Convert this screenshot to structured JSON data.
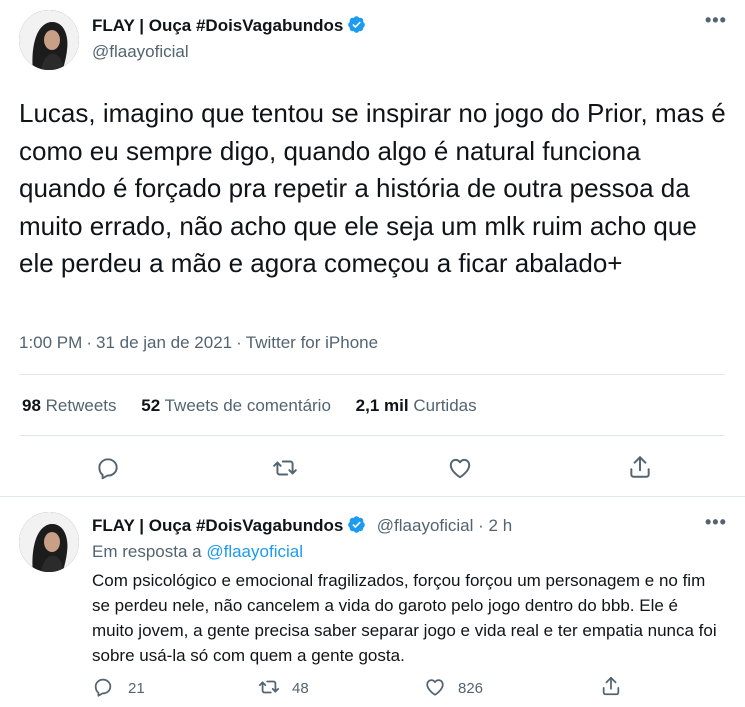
{
  "tweet": {
    "author_name": "FLAY | Ouça #DoisVagabundos",
    "handle": "@flaayoficial",
    "more_icon": "more-horizontal-icon",
    "text": "Lucas, imagino que tentou se inspirar no jogo do Prior, mas é como eu sempre digo, quando algo é natural funciona quando é forçado pra repetir a história de outra pessoa da muito errado, não acho que ele seja um mlk ruim acho que ele perdeu a mão e agora começou a ficar abalado+",
    "time": "1:00 PM",
    "date": "31 de jan de 2021",
    "source": "Twitter for iPhone",
    "stats": {
      "retweets_count": "98",
      "retweets_label": "Retweets",
      "quotes_count": "52",
      "quotes_label": "Tweets de comentário",
      "likes_count": "2,1 mil",
      "likes_label": "Curtidas"
    }
  },
  "reply": {
    "author_name": "FLAY | Ouça #DoisVagabundos",
    "handle": "@flaayoficial",
    "age": "2 h",
    "reply_to_prefix": "Em resposta a",
    "reply_to_handle": "@flaayoficial",
    "text": "Com psicológico e emocional fragilizados, forçou forçou um personagem e no fim se perdeu nele, não cancelem a vida do garoto pelo jogo dentro do bbb. Ele é muito jovem, a gente precisa saber separar jogo e vida real  e ter empatia nunca foi sobre usá-la só com quem a gente gosta.",
    "replies": "21",
    "retweets": "48",
    "likes": "826"
  },
  "colors": {
    "accent": "#1d9bf0",
    "secondary_text": "#536471",
    "divider": "#e1e8ed"
  }
}
